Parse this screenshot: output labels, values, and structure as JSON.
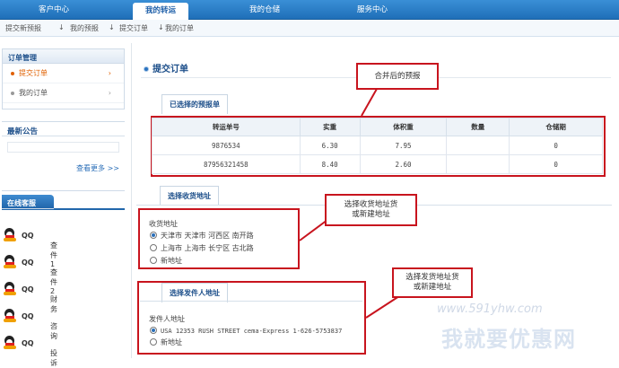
{
  "topnav": {
    "tabs": [
      {
        "label": "客户中心",
        "active": false
      },
      {
        "label": "我的转运",
        "active": true
      },
      {
        "label": "我的仓储",
        "active": false
      },
      {
        "label": "服务中心",
        "active": false
      }
    ]
  },
  "steps": [
    {
      "label": "提交新预报",
      "arrow": "↓"
    },
    {
      "label": "我的预报",
      "arrow": "↓"
    },
    {
      "label": "提交订单",
      "arrow": "↓"
    },
    {
      "label": "我的订单",
      "arrow": "↓"
    }
  ],
  "sidebar": {
    "order_mgmt_title": "订单管理",
    "items": [
      {
        "label": "提交订单",
        "arrow": "›"
      },
      {
        "label": "我的订单",
        "arrow": "›"
      }
    ],
    "notice_title": "最新公告",
    "more_label": "查看更多 >>",
    "cs_title": "在线客服",
    "cs": [
      {
        "qq": "QQ",
        "label": "查件1"
      },
      {
        "qq": "QQ",
        "label": "查件2"
      },
      {
        "qq": "QQ",
        "label": "财务"
      },
      {
        "qq": "QQ",
        "label": "咨询"
      },
      {
        "qq": "QQ",
        "label": "投诉"
      }
    ]
  },
  "main": {
    "page_title": "提交订单",
    "selected_tab": "已选择的预报单",
    "table": {
      "headers": [
        "转运单号",
        "实重",
        "体积重",
        "数量",
        "仓储期"
      ],
      "rows": [
        [
          "9876534",
          "6.30",
          "7.95",
          "",
          "0"
        ],
        [
          "87956321458",
          "8.40",
          "2.60",
          "",
          "0"
        ]
      ]
    },
    "recv_tab": "选择收货地址",
    "recv_label": "收货地址",
    "recv_options": [
      {
        "label": "天津市 天津市 河西区 南开路",
        "checked": true
      },
      {
        "label": "上海市 上海市 长宁区 古北路",
        "checked": false
      },
      {
        "label": "新地址",
        "checked": false
      }
    ],
    "sender_tab": "选择发件人地址",
    "sender_label": "发件人地址",
    "sender_options": [
      {
        "label": "USA 12353 RUSH STREET cema-Express 1-626-5753837",
        "checked": true
      },
      {
        "label": "新地址",
        "checked": false
      }
    ]
  },
  "callouts": {
    "merged": "合并后的预报",
    "recv": "选择收货地址货\n或新建地址",
    "sender": "选择发货地址货\n或新建地址"
  },
  "watermark": {
    "url": "www.591yhw.com",
    "cn": "我就要优惠网"
  },
  "colors": {
    "nav_blue": "#2a7cc7",
    "accent_orange": "#e06000",
    "annotation_red": "#c8141e"
  }
}
